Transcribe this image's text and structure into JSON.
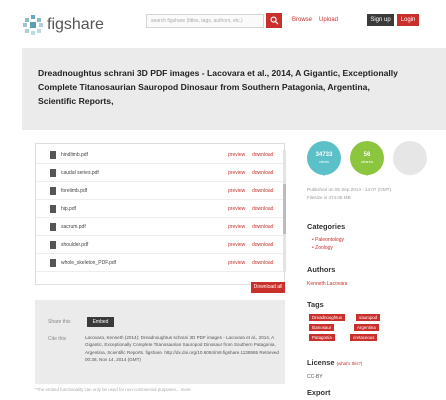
{
  "header": {
    "logo_text": "figshare",
    "search_placeholder": "search figshare (titles, tags, authors, etc.)",
    "browse_label": "Browse",
    "upload_label": "Upload",
    "signup_label": "Sign up",
    "login_label": "Login"
  },
  "article": {
    "title": "Dreadnoughtus schrani 3D PDF images - Lacovara et al., 2014, A Gigantic, Exceptionally Complete Titanosaurian Sauropod Dinosaur from Southern Patagonia, Argentina, Scientific Reports,"
  },
  "files": {
    "preview_label": "preview",
    "download_label": "download",
    "items": [
      {
        "name": "hindlimb.pdf"
      },
      {
        "name": "caudal series.pdf"
      },
      {
        "name": "forelimb.pdf"
      },
      {
        "name": "hip.pdf"
      },
      {
        "name": "sacrum.pdf"
      },
      {
        "name": "shoulder.pdf"
      },
      {
        "name": "whole_skeleton_PDF.pdf"
      }
    ],
    "download_all_label": "Download all"
  },
  "share": {
    "share_label": "Share this",
    "embed_label": "Embed",
    "cite_label": "Cite this",
    "citation": "Lacovara, Kenneth (2014): Dreadnoughtus schrani 3D PDF images - Lacovara et al., 2014, A Gigantic, Exceptionally Complete Titanosaurian Sauropod Dinosaur from Southern Patagonia, Argentina, Scientific Reports. figshare. http://dx.doi.org/10.6084/m9.figshare.1138965 Retrieved 00:38, Nov 14, 2014 (GMT)",
    "note": "*The embed functionality can only be used for non-commercial purposes... more"
  },
  "stats": {
    "views_value": "34733",
    "views_label": "views",
    "shares_value": "56",
    "shares_label": "shares",
    "views_color": "#5bc0c7",
    "shares_color": "#8cc63f",
    "third_color": "#e6e6e6"
  },
  "sidebar": {
    "published": "Published on 06 Sep 2014 - 14:07 (GMT)",
    "filesize": "Filesize is 474.05 MB",
    "categories_heading": "Categories",
    "categories": [
      "Paleontology",
      "Zoology"
    ],
    "authors_heading": "Authors",
    "author": "Kenneth Lacovara",
    "tags_heading": "Tags",
    "tags": [
      "Dreadnoughtus",
      "sauropod",
      "titanosaur",
      "Argentina",
      "Patagonia",
      "cretaceous"
    ],
    "license_heading": "License",
    "license_link": "(what's this?)",
    "license": "CC-BY",
    "export_heading": "Export"
  }
}
